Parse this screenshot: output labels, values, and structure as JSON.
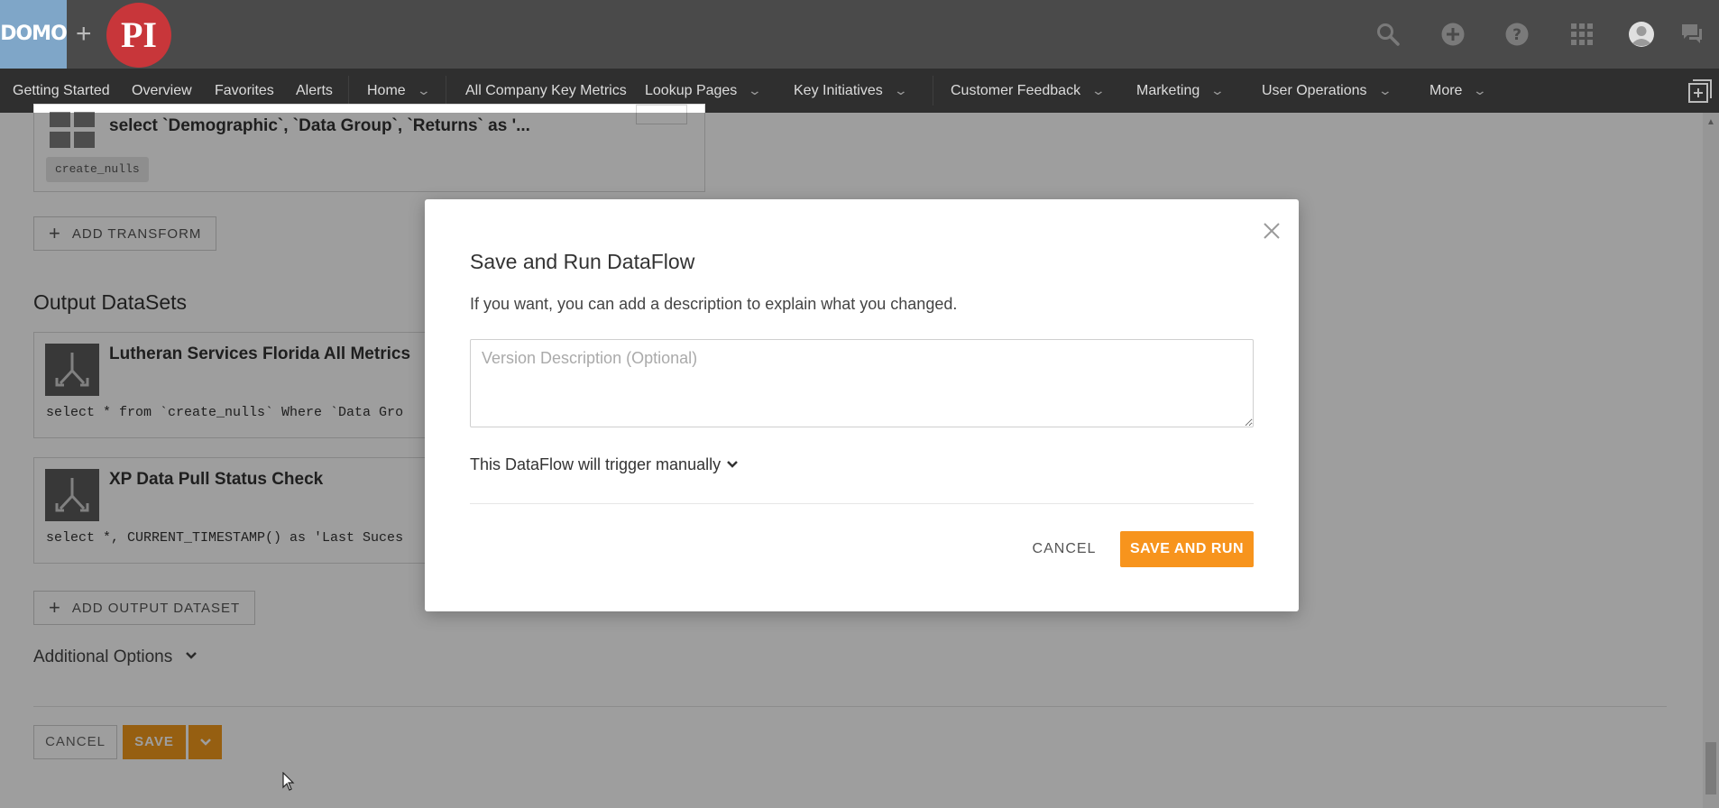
{
  "topbar": {
    "logo_text": "DOMO",
    "plus": "+",
    "partner_logo": "PI",
    "icons": [
      "search-icon",
      "add-circle-icon",
      "help-icon",
      "app-grid-icon",
      "avatar-icon",
      "chat-icon"
    ]
  },
  "nav": {
    "items": [
      {
        "label": "Getting Started"
      },
      {
        "label": "Overview"
      },
      {
        "label": "Favorites"
      },
      {
        "label": "Alerts"
      },
      {
        "label": "Home",
        "dropdown": true
      },
      {
        "label": "All Company Key Metrics"
      },
      {
        "label": "Lookup Pages",
        "dropdown": true
      },
      {
        "label": "Key Initiatives",
        "dropdown": true
      },
      {
        "label": "Customer Feedback",
        "dropdown": true
      },
      {
        "label": "Marketing",
        "dropdown": true
      },
      {
        "label": "User Operations",
        "dropdown": true
      },
      {
        "label": "More",
        "dropdown": true
      }
    ]
  },
  "editor": {
    "transform": {
      "sql": "select `Demographic`, `Data Group`, `Returns` as '...",
      "chip": "create_nulls"
    },
    "add_transform_label": "ADD TRANSFORM",
    "output_title": "Output DataSets",
    "outputs": [
      {
        "name": "Lutheran Services Florida All Metrics",
        "sql": "select * from `create_nulls` Where `Data Gro"
      },
      {
        "name": "XP Data Pull Status Check",
        "sql": "select *, CURRENT_TIMESTAMP() as 'Last Suces"
      }
    ],
    "add_output_label": "ADD OUTPUT DATASET",
    "additional_options": "Additional Options",
    "cancel_label": "CANCEL",
    "save_label": "SAVE"
  },
  "modal": {
    "title": "Save and Run DataFlow",
    "description": "If you want, you can add a description to explain what you changed.",
    "textarea_placeholder": "Version Description (Optional)",
    "textarea_value": "",
    "trigger_text": "This DataFlow will trigger manually",
    "cancel_label": "CANCEL",
    "save_run_label": "SAVE AND RUN"
  },
  "colors": {
    "accent": "#f7941d",
    "topbar": "#4a4a4a",
    "navbar": "#2f2f2f"
  }
}
